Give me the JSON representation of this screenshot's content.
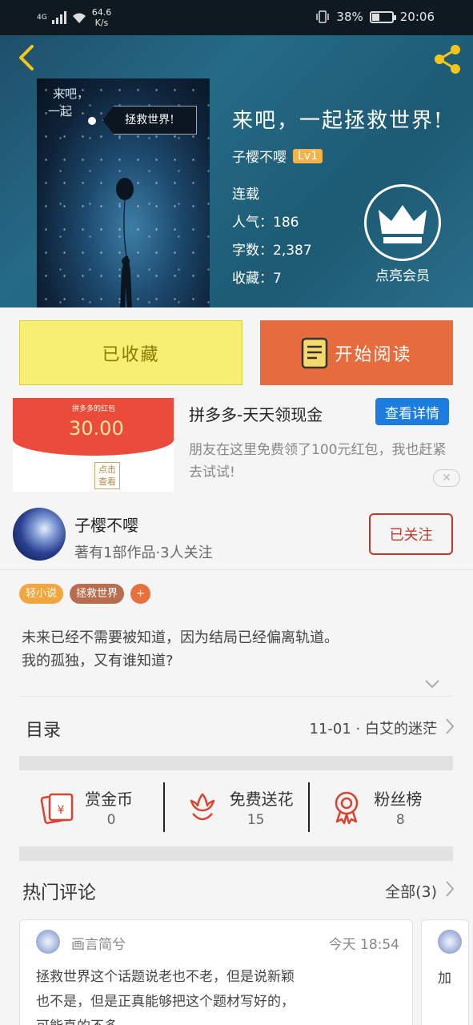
{
  "status_bar": {
    "network": "4G",
    "speed_value": "64.6",
    "speed_unit": "K/s",
    "battery": "38%",
    "battery_level": 0.38,
    "time": "20:06"
  },
  "book": {
    "title": "来吧，一起拯救世界!",
    "author": "子樱不嘤",
    "author_level": "Lv1",
    "status": "连载",
    "popularity": "人气：186",
    "word_count": "字数：2,387",
    "favorites": "收藏：7",
    "cover_handwriting_1": "来吧，",
    "cover_handwriting_2": "一起",
    "cover_tag": "拯救世界!"
  },
  "vip": {
    "label": "点亮会员"
  },
  "actions": {
    "collected_label": "已收藏",
    "read_label": "开始阅读"
  },
  "ad": {
    "image_brand": "拼多多的红包",
    "image_amount": "30.00",
    "image_seal": "点击查看",
    "title": "拼多多-天天领现金",
    "button": "查看详情",
    "description": "朋友在这里免费领了100元红包，我也赶紧去试试!"
  },
  "author_card": {
    "name": "子樱不嘤",
    "subtitle": "著有1部作品·3人关注",
    "follow_label": "已关注"
  },
  "tags": [
    {
      "label": "轻小说",
      "color": "#f2a640"
    },
    {
      "label": "拯救世界",
      "color": "#b86e4e"
    },
    {
      "label": "+",
      "color": "#e8703e"
    }
  ],
  "synopsis": {
    "line1": "未来已经不需要被知道，因为结局已经偏离轨道。",
    "line2": "我的孤独，又有谁知道?"
  },
  "toc": {
    "label": "目录",
    "latest": "11-01 · 白艾的迷茫"
  },
  "stats": [
    {
      "name": "赏金币",
      "value": "0",
      "icon": "red-envelope-icon"
    },
    {
      "name": "免费送花",
      "value": "15",
      "icon": "flower-icon"
    },
    {
      "name": "粉丝榜",
      "value": "8",
      "icon": "medal-icon"
    }
  ],
  "hot_comments": {
    "label": "热门评论",
    "all_label": "全部(3)"
  },
  "comments": [
    {
      "user": "画言简兮",
      "time": "今天 18:54",
      "line1": "拯救世界这个话题说老也不老，但是说新颖",
      "line2": "也不是，但是正真能够把这个题材写好的，",
      "line3": "可能真的不多。。。"
    },
    {
      "text": "加"
    }
  ],
  "colors": {
    "header_bg": "#256a86",
    "collected_bg": "#f7ef73",
    "read_bg": "#e76c3d",
    "follow_border": "#c0392b",
    "ad_button": "#1c7ce0"
  }
}
